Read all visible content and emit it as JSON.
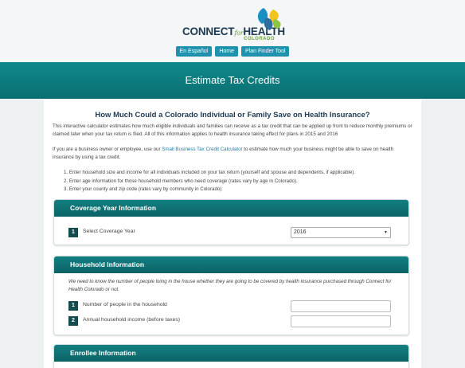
{
  "brand": {
    "name_part1": "CONNECT",
    "name_for": "for",
    "name_part2": "HEALTH",
    "state": "COLORADO"
  },
  "nav": [
    {
      "label": "En Español"
    },
    {
      "label": "Home"
    },
    {
      "label": "Plan Finder Tool"
    }
  ],
  "banner": {
    "title": "Estimate Tax Credits"
  },
  "intro": {
    "heading": "How Much Could a Colorado Individual or Family Save on Health Insurance?",
    "para1": "This interactive calculator estimates how much eligible individuals and families can receive as a tax credit that can be applied up front to reduce monthly premiums or claimed later when your tax return is filed. All of this information applies to health insurance taking effect for plans in 2015 and 2016",
    "para2_before": "If you are a business owner or employee, use our ",
    "para2_link": "Small Business Tax Credit Calculator",
    "para2_after": " to estimate how much your business might be able to save on health insurance by using a tax credit.",
    "steps": [
      "1. Enter household size and income for all individuals included on your tax return (yourself and spouse and dependents, if applicable).",
      "2. Enter age information for those household members who need coverage (rates vary by age in Colorado).",
      "3. Enter your county and zip code (rates vary by community in Colorado)"
    ]
  },
  "coverage": {
    "title": "Coverage Year Information",
    "step_num": "1",
    "label": "Select Coverage Year",
    "selected": "2016"
  },
  "household": {
    "title": "Household Information",
    "note": "We need to know the number of people living in the house whether they are going to be covered by health insurance purchased through Connect for Health Colorado or not.",
    "fields": [
      {
        "num": "1",
        "label": "Number of people in the household",
        "value": ""
      },
      {
        "num": "2",
        "label": "Annual household income (before taxes)",
        "value": ""
      }
    ]
  },
  "enrollee": {
    "title": "Enrollee Information"
  },
  "colors": {
    "teal": "#0f8a8d",
    "navy": "#1d3a52",
    "button": "#1f93ad",
    "green": "#6aa23a"
  }
}
